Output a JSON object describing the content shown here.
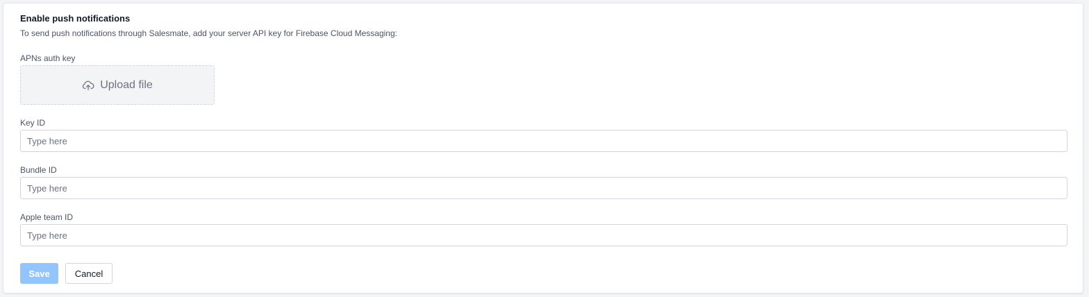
{
  "section": {
    "title": "Enable push notifications",
    "description": "To send push notifications through Salesmate, add your server API key for Firebase Cloud Messaging:"
  },
  "apns": {
    "label": "APNs auth key",
    "upload_label": "Upload file",
    "icon": "cloud-upload-icon"
  },
  "fields": {
    "key_id": {
      "label": "Key ID",
      "placeholder": "Type here",
      "value": ""
    },
    "bundle_id": {
      "label": "Bundle ID",
      "placeholder": "Type here",
      "value": ""
    },
    "apple_team_id": {
      "label": "Apple team ID",
      "placeholder": "Type here",
      "value": ""
    }
  },
  "actions": {
    "save_label": "Save",
    "cancel_label": "Cancel"
  },
  "colors": {
    "save_disabled_bg": "#93c5fd",
    "upload_bg": "#f3f4f6",
    "border": "#d1d5db"
  }
}
